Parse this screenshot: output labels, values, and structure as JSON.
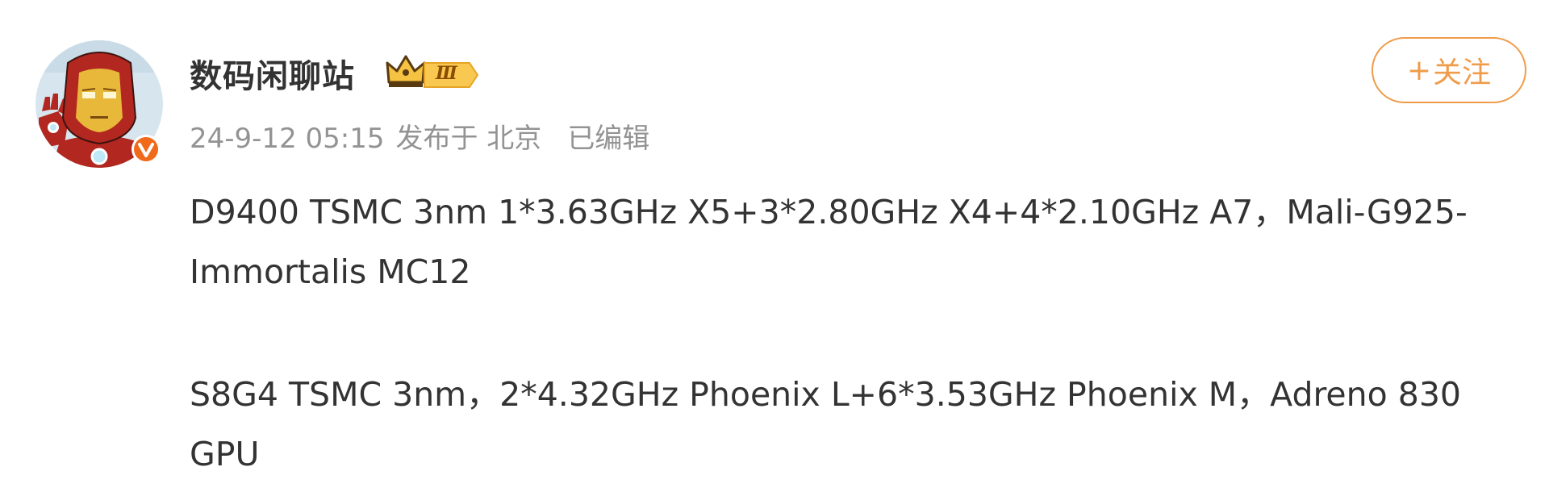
{
  "post": {
    "author": {
      "name": "数码闲聊站",
      "level_badge": "Ⅲ",
      "avatar_icon": "iron-man-avatar-icon",
      "verified_icon": "verified-v-icon",
      "crown_icon": "crown-icon"
    },
    "meta": {
      "time": "24-9-12 05:15",
      "location": "发布于 北京",
      "edited": "已编辑"
    },
    "follow_label": "关注",
    "follow_plus": "+",
    "content": {
      "paragraph1_line1": "D9400 TSMC 3nm 1*3.63GHz X5+3*2.80GHz X4+4*2.10GHz A7，Mali-G925-",
      "paragraph1_line2": "Immortalis MC12",
      "paragraph2_line1": "S8G4 TSMC 3nm，2*4.32GHz Phoenix L+6*3.53GHz Phoenix M，Adreno 830",
      "paragraph2_line2": "GPU"
    },
    "colors": {
      "accent": "#ef9c4a",
      "meta_text": "#939393",
      "body_text": "#333333",
      "verified": "#f06a1a"
    }
  }
}
